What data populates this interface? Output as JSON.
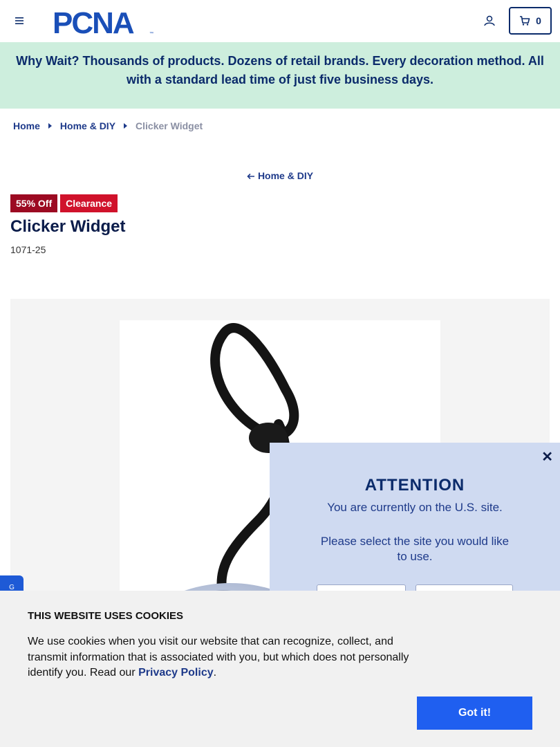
{
  "header": {
    "logo_text": "PCNA",
    "cart_count": "0"
  },
  "banner": {
    "text": "Why Wait? Thousands of products. Dozens of retail brands. Every decoration method. All with a standard lead time of just five business days."
  },
  "breadcrumb": {
    "items": [
      "Home",
      "Home & DIY"
    ],
    "current": "Clicker Widget"
  },
  "back_link": "Home & DIY",
  "product": {
    "badges": [
      "55% Off",
      "Clearance"
    ],
    "title": "Clicker Widget",
    "sku": "1071-25"
  },
  "feedback_tab": "G",
  "site_modal": {
    "close": "✕",
    "title": "ATTENTION",
    "line1": "You are currently on the U.S. site.",
    "line2": "Please select the site you would like to use."
  },
  "cookies": {
    "title": "THIS WEBSITE USES COOKIES",
    "text_before": "We use cookies when you visit our website that can recognize, collect, and transmit information that is associated with you, but which does not personally identify you. Read our ",
    "link": "Privacy Policy",
    "text_after": ".",
    "button": "Got it!"
  },
  "colors": {
    "brand_navy": "#0b2b6b",
    "banner_bg": "#cdeedd",
    "sale_badge": "#9c0a22",
    "clearance_badge": "#d0122b",
    "accept_button": "#1f5ff0",
    "modal_bg": "#cfdaf1"
  },
  "icons": [
    "hamburger-menu-icon",
    "account-icon",
    "cart-icon",
    "arrow-left-icon",
    "caret-right-icon",
    "close-icon"
  ]
}
